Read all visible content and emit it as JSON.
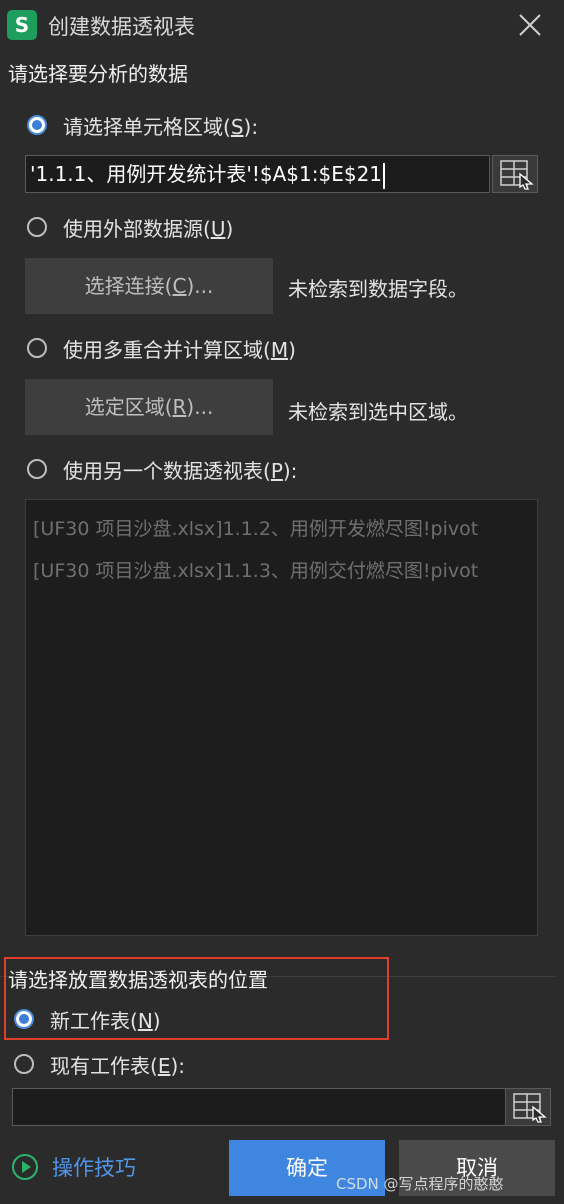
{
  "window": {
    "app_icon_letter": "S",
    "title": "创建数据透视表"
  },
  "source_section": {
    "title": "请选择要分析的数据",
    "option_range": {
      "label": "请选择单元格区域(",
      "key": "S",
      "suffix": "):",
      "checked": true
    },
    "range_value": "'1.1.1、用例开发统计表'!$A$1:$E$21",
    "option_external": {
      "label": "使用外部数据源(",
      "key": "U",
      "suffix": ")",
      "checked": false
    },
    "select_connection_button": {
      "label": "选择连接(",
      "key": "C",
      "suffix": ")..."
    },
    "external_hint": "未检索到数据字段。",
    "option_consolidation": {
      "label": "使用多重合并计算区域(",
      "key": "M",
      "suffix": ")",
      "checked": false
    },
    "select_range_button": {
      "label": "选定区域(",
      "key": "R",
      "suffix": ")..."
    },
    "consolidation_hint": "未检索到选中区域。",
    "option_other_pivot": {
      "label": "使用另一个数据透视表(",
      "key": "P",
      "suffix": "):",
      "checked": false
    },
    "pivot_tables": [
      "[UF30 项目沙盘.xlsx]1.1.2、用例开发燃尽图!pivot",
      "[UF30 项目沙盘.xlsx]1.1.3、用例交付燃尽图!pivot"
    ]
  },
  "destination_section": {
    "title": "请选择放置数据透视表的位置",
    "option_new_sheet": {
      "label": "新工作表(",
      "key": "N",
      "suffix": ")",
      "checked": true
    },
    "option_existing_sheet": {
      "label": "现有工作表(",
      "key": "E",
      "suffix": "):",
      "checked": false
    },
    "existing_sheet_value": ""
  },
  "footer": {
    "tips_label": "操作技巧",
    "ok_label": "确定",
    "cancel_label": "取消",
    "watermark": "CSDN @写点程序的憨憨"
  },
  "colors": {
    "background": "#2b2b2b",
    "accent": "#3f86e0",
    "highlight_border": "#e0402a",
    "tips_icon": "#2bb56a"
  }
}
